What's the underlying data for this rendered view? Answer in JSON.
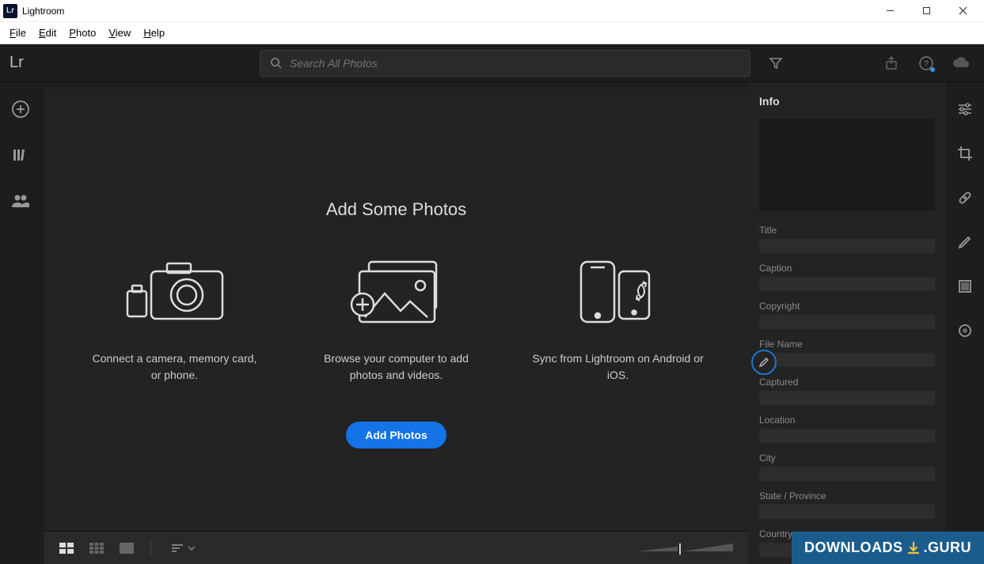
{
  "window": {
    "title": "Lightroom"
  },
  "menu": {
    "items": [
      "File",
      "Edit",
      "Photo",
      "View",
      "Help"
    ]
  },
  "header": {
    "logo": "Lr",
    "search_placeholder": "Search All Photos"
  },
  "main": {
    "heading": "Add Some Photos",
    "cards": [
      {
        "text": "Connect a camera, memory card, or phone."
      },
      {
        "text": "Browse your computer to add photos and videos."
      },
      {
        "text": "Sync from Lightroom on Android or iOS."
      }
    ],
    "add_button": "Add Photos"
  },
  "info_panel": {
    "title": "Info",
    "fields": [
      "Title",
      "Caption",
      "Copyright",
      "File Name",
      "Captured",
      "Location",
      "City",
      "State / Province",
      "Country"
    ]
  },
  "watermark": {
    "text_left": "DOWNLOADS",
    "text_right": ".GURU"
  }
}
